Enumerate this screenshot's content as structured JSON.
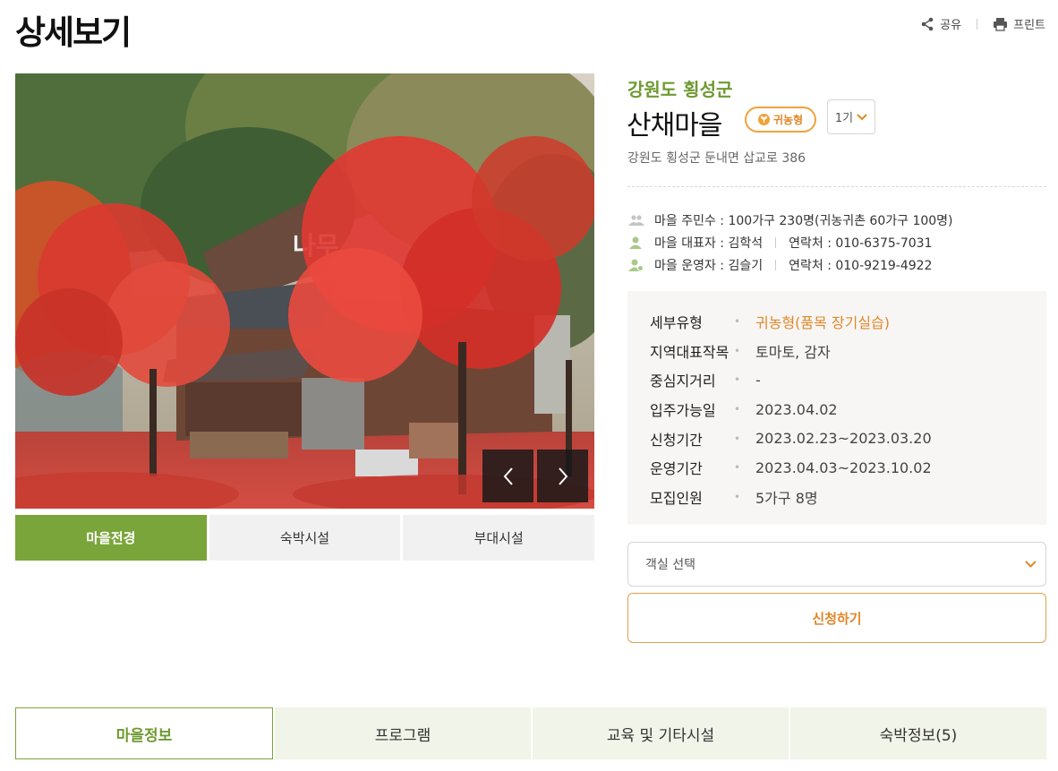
{
  "header": {
    "title": "상세보기",
    "share_label": "공유",
    "print_label": "프린트"
  },
  "gallery": {
    "photo_text": "나무",
    "tabs": [
      {
        "label": "마을전경",
        "active": true
      },
      {
        "label": "숙박시설",
        "active": false
      },
      {
        "label": "부대시설",
        "active": false
      }
    ]
  },
  "village": {
    "region": "강원도 횡성군",
    "name": "산채마을",
    "type_badge": "귀농형",
    "generation": "1기",
    "address": "강원도 횡성군 둔내면 삽교로 386"
  },
  "info": {
    "residents": "마을 주민수 : 100가구 230명(귀농귀촌 60가구 100명)",
    "representative": "마을 대표자 : 김학석",
    "representative_contact": "연락처 : 010-6375-7031",
    "operator": "마을 운영자 : 김슬기",
    "operator_contact": "연락처 : 010-9219-4922"
  },
  "details": [
    {
      "key": "세부유형",
      "value": "귀농형(품목 장기실습)"
    },
    {
      "key": "지역대표작목",
      "value": "토마토, 감자"
    },
    {
      "key": "중심지거리",
      "value": "-"
    },
    {
      "key": "입주가능일",
      "value": "2023.04.02"
    },
    {
      "key": "신청기간",
      "value": "2023.02.23~2023.03.20"
    },
    {
      "key": "운영기간",
      "value": "2023.04.03~2023.10.02"
    },
    {
      "key": "모집인원",
      "value": "5가구 8명"
    }
  ],
  "room_select": {
    "placeholder": "객실 선택"
  },
  "apply_label": "신청하기",
  "bottom_tabs": [
    {
      "label": "마을정보",
      "active": true
    },
    {
      "label": "프로그램",
      "active": false
    },
    {
      "label": "교육 및 기타시설",
      "active": false
    },
    {
      "label": "숙박정보(5)",
      "active": false
    }
  ],
  "colors": {
    "accent_green": "#7aa53a",
    "accent_orange": "#e0882a"
  }
}
